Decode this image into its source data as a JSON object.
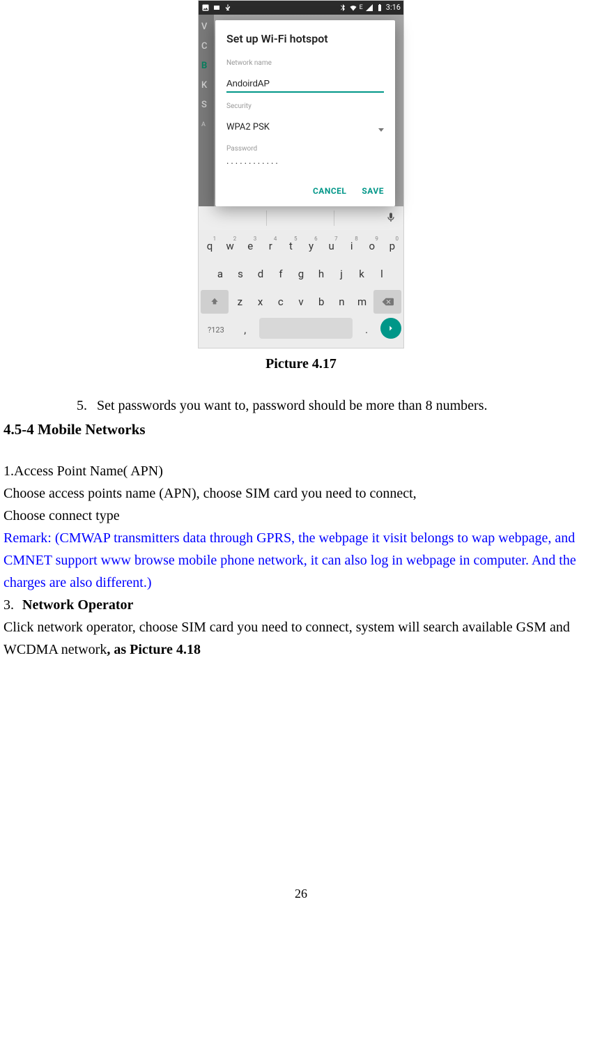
{
  "screenshot": {
    "status": {
      "time": "3:16",
      "signal_label": "E"
    },
    "bg_letters": [
      "V",
      "C",
      "B",
      "K",
      "S",
      "A"
    ],
    "dialog": {
      "title": "Set up Wi-Fi hotspot",
      "network_label": "Network name",
      "network_value": "AndoirdAP",
      "security_label": "Security",
      "security_value": "WPA2 PSK",
      "password_label": "Password",
      "password_value": "············",
      "cancel": "CANCEL",
      "save": "SAVE"
    },
    "keyboard": {
      "row1": [
        "q",
        "w",
        "e",
        "r",
        "t",
        "y",
        "u",
        "i",
        "o",
        "p"
      ],
      "row1_sup": [
        "1",
        "2",
        "3",
        "4",
        "5",
        "6",
        "7",
        "8",
        "9",
        "0"
      ],
      "row2": [
        "a",
        "s",
        "d",
        "f",
        "g",
        "h",
        "j",
        "k",
        "l"
      ],
      "row3": [
        "z",
        "x",
        "c",
        "v",
        "b",
        "n",
        "m"
      ],
      "sym": "?123",
      "comma": ",",
      "dot": "."
    }
  },
  "caption": "Picture 4.17",
  "item5_num": "5.",
  "item5_text": "Set passwords you want to, password should be more than 8 numbers.",
  "h454": "4.5-4 Mobile Networks",
  "p_apn_title": "1.Access Point Name( APN)",
  "p_apn_1": "Choose access points name (APN), choose SIM card you need to connect,",
  "p_apn_2": "Choose connect type",
  "remark": "Remark: (CMWAP transmitters data through GPRS, the webpage it visit belongs to wap webpage, and CMNET support www browse mobile phone network, it can also log in webpage in computer. And the charges are also different.)",
  "op_num": "3.",
  "op_title": "Network Operator",
  "op_text_a": "Click network operator, choose SIM card you need to connect, system will search available GSM and WCDMA network",
  "op_text_b": ", as Picture 4.18",
  "page_number": "26"
}
